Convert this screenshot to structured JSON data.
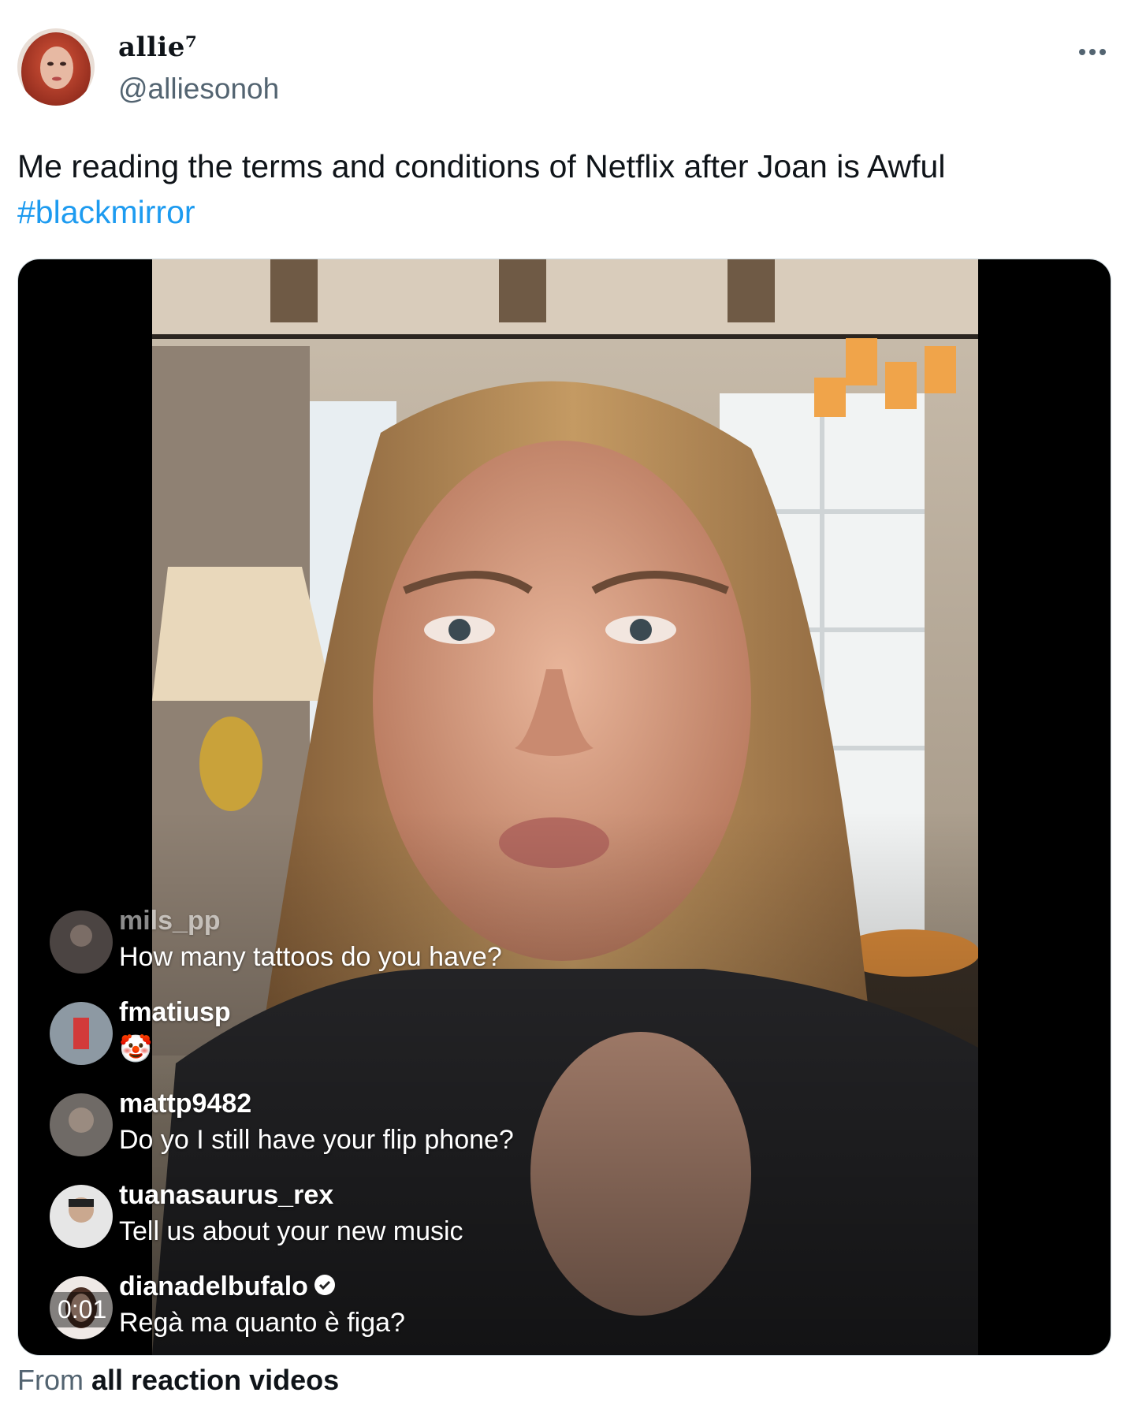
{
  "tweet": {
    "display_name": "allie⁷",
    "handle": "@alliesonoh",
    "more_icon": "more-horizontal-icon",
    "text": "Me reading the terms and conditions of Netflix after Joan is Awful",
    "hashtag": "#blackmirror"
  },
  "video": {
    "timestamp": "0:01",
    "comments": [
      {
        "user": "mils_pp",
        "text": "How many tattoos do you have?"
      },
      {
        "user": "fmatiusp",
        "text": "🤡"
      },
      {
        "user": "mattp9482",
        "text": "Do yo I still have your flip phone?"
      },
      {
        "user": "tuanasaurus_rex",
        "text": "Tell us about your new music"
      },
      {
        "user": "dianadelbufalo",
        "text": "Regà ma quanto è figa?"
      }
    ]
  },
  "source": {
    "prefix": "From",
    "name": "all reaction videos"
  },
  "colors": {
    "link": "#1d9bf0",
    "secondary_text": "#536471"
  }
}
